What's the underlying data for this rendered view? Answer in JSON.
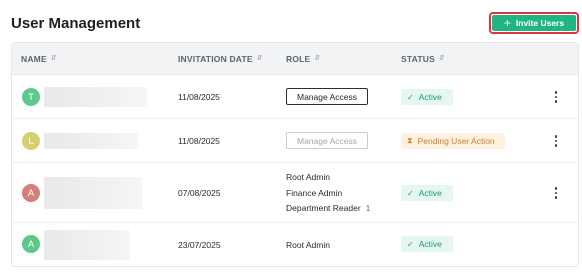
{
  "header": {
    "title": "User Management",
    "invite_button_label": "Invite Users",
    "invite_button_icon": "plus-icon"
  },
  "colors": {
    "accent": "#20b684",
    "highlight_border": "#e0313e",
    "active_text": "#1a9b6e",
    "pending_text": "#c9832a"
  },
  "table": {
    "columns": [
      "NAME",
      "INVITATION DATE",
      "ROLE",
      "STATUS"
    ],
    "rows": [
      {
        "avatar_letter": "T",
        "avatar_color": "#5cc98a",
        "invitation_date": "11/08/2025",
        "role": {
          "type": "button",
          "label": "Manage Access",
          "enabled": true
        },
        "status": "Active",
        "status_icon": "check-icon",
        "has_menu": true
      },
      {
        "avatar_letter": "L",
        "avatar_color": "#d6cf72",
        "invitation_date": "11/08/2025",
        "role": {
          "type": "button",
          "label": "Manage Access",
          "enabled": false
        },
        "status": "Pending User Action",
        "status_icon": "pending-icon",
        "has_menu": true
      },
      {
        "avatar_letter": "A",
        "avatar_color": "#d67f78",
        "invitation_date": "07/08/2025",
        "role": {
          "type": "list",
          "items": [
            "Root Admin",
            "Finance Admin",
            "Department Reader"
          ],
          "extra_count": "1"
        },
        "status": "Active",
        "status_icon": "check-icon",
        "has_menu": true
      },
      {
        "avatar_letter": "A",
        "avatar_color": "#5cc98a",
        "invitation_date": "23/07/2025",
        "role": {
          "type": "text",
          "label": "Root Admin"
        },
        "status": "Active",
        "status_icon": "check-icon",
        "has_menu": false
      }
    ]
  }
}
